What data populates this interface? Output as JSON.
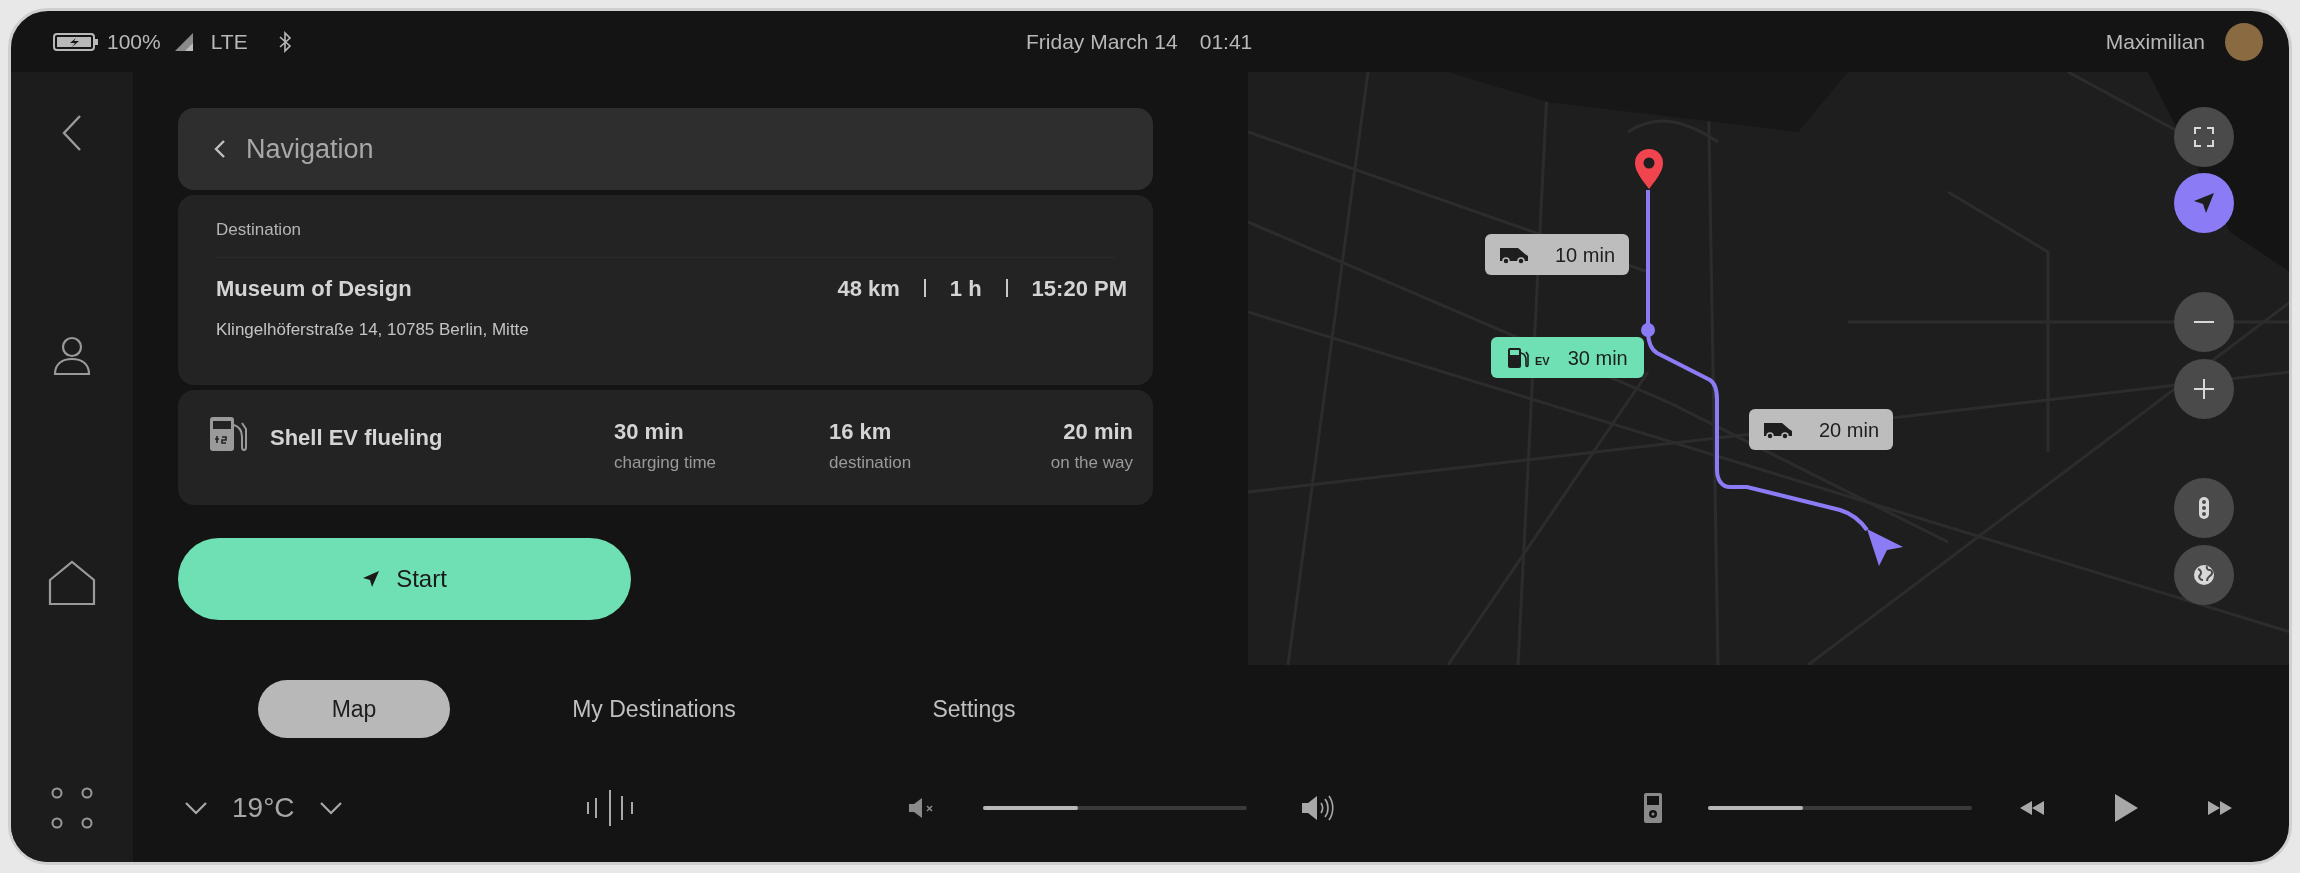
{
  "status_bar": {
    "battery": "100%",
    "network": "LTE",
    "date": "Friday March 14",
    "time": "01:41",
    "user": "Maximilian"
  },
  "navigation": {
    "title": "Navigation",
    "destination": {
      "label": "Destination",
      "name": "Museum of Design",
      "address": "Klingelhöferstraße 14, 10785 Berlin, Mitte",
      "distance": "48 km",
      "duration": "1 h",
      "arrival": "15:20 PM"
    },
    "station": {
      "name": "Shell EV flueling",
      "stats": [
        {
          "value": "30 min",
          "label": "charging time"
        },
        {
          "value": "16 km",
          "label": "destination"
        },
        {
          "value": "20 min",
          "label": "on the way"
        }
      ]
    },
    "start_button": "Start"
  },
  "map": {
    "callouts": [
      {
        "kind": "vehicle",
        "text": "10 min"
      },
      {
        "kind": "charging",
        "badge": "EV",
        "text": "30 min"
      },
      {
        "kind": "vehicle",
        "text": "20 min"
      }
    ],
    "controls": [
      {
        "kind": "fullscreen",
        "active": false
      },
      {
        "kind": "locate",
        "active": true
      },
      {
        "kind": "zoom_out",
        "active": false
      },
      {
        "kind": "zoom_in",
        "active": false
      },
      {
        "kind": "traffic",
        "active": false
      },
      {
        "kind": "globe",
        "active": false
      }
    ]
  },
  "tabs": [
    {
      "label": "Map",
      "selected": true
    },
    {
      "label": "My Destinations",
      "selected": false
    },
    {
      "label": "Settings",
      "selected": false
    }
  ],
  "bottom_bar": {
    "temperature": "19°C",
    "volume": {
      "level": 0.36
    },
    "media": {
      "level": 0.36
    }
  }
}
